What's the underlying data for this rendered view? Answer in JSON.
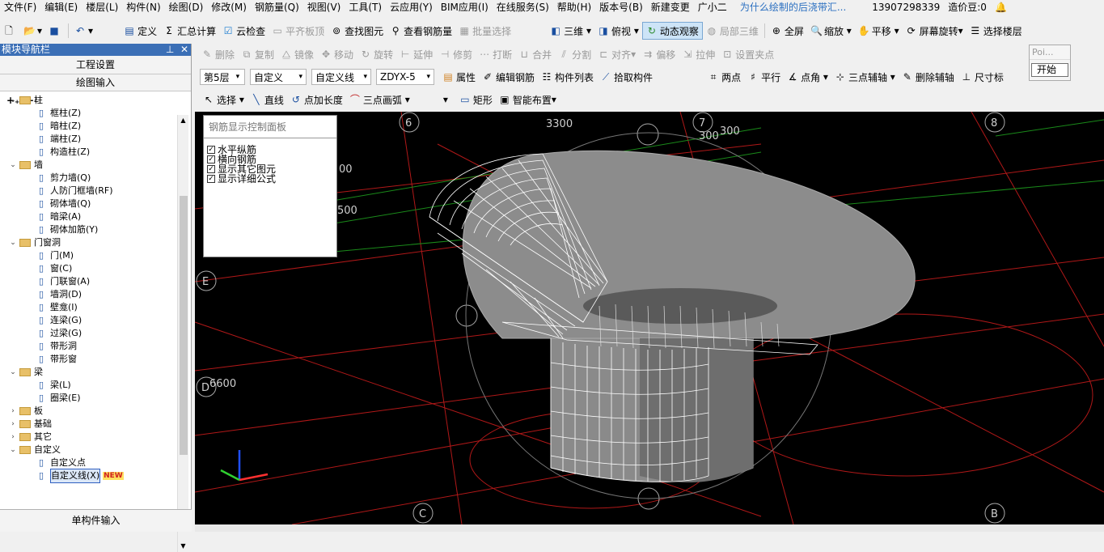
{
  "menu": {
    "items": [
      "文件(F)",
      "编辑(E)",
      "楼层(L)",
      "构件(N)",
      "绘图(D)",
      "修改(M)",
      "钢筋量(Q)",
      "视图(V)",
      "工具(T)",
      "云应用(Y)",
      "BIM应用(I)",
      "在线服务(S)",
      "帮助(H)",
      "版本号(B)",
      "新建变更",
      "广小二",
      "为什么绘制的后浇带汇..."
    ],
    "phone": "13907298339",
    "coins": "造价豆:0"
  },
  "toolbar1": {
    "define": "定义",
    "sum": "汇总计算",
    "cloud_check": "云检查",
    "flush_slab": "平齐板顶",
    "find": "查找图元",
    "view_rebar": "查看钢筋量",
    "batch_select": "批量选择",
    "view_3d": "三维",
    "top_view": "俯视",
    "dynamic_view": "动态观察",
    "local_3d": "局部三维",
    "fullscreen": "全屏",
    "zoom": "缩放",
    "pan": "平移",
    "rotate_screen": "屏幕旋转",
    "select_floor": "选择楼层"
  },
  "toolbar2": {
    "delete": "删除",
    "copy": "复制",
    "mirror": "镜像",
    "move": "移动",
    "rotate": "旋转",
    "extend": "延伸",
    "trim": "修剪",
    "break": "打断",
    "merge": "合并",
    "split": "分割",
    "align": "对齐",
    "offset": "偏移",
    "stretch": "拉伸",
    "set_grip": "设置夹点"
  },
  "toolbar3": {
    "floor": "第5层",
    "category": "自定义",
    "sub_category": "自定义线",
    "component": "ZDYX-5",
    "properties": "属性",
    "edit_rebar": "编辑钢筋",
    "component_list": "构件列表",
    "pick": "拾取构件",
    "two_points": "两点",
    "parallel": "平行",
    "point_angle": "点角",
    "three_point_aux": "三点辅轴",
    "delete_aux": "删除辅轴",
    "dimension": "尺寸标"
  },
  "toolbar4": {
    "select": "选择",
    "line": "直线",
    "point_length": "点加长度",
    "arc": "三点画弧",
    "rect": "矩形",
    "smart_layout": "智能布置"
  },
  "sidebar": {
    "title": "模块导航栏",
    "project_settings": "工程设置",
    "drawing_input": "绘图输入",
    "single_input": "单构件输入",
    "tree": [
      {
        "label": "柱",
        "type": "folder",
        "expanded": true
      },
      {
        "label": "框柱(Z)",
        "type": "leaf"
      },
      {
        "label": "暗柱(Z)",
        "type": "leaf"
      },
      {
        "label": "端柱(Z)",
        "type": "leaf"
      },
      {
        "label": "构造柱(Z)",
        "type": "leaf"
      },
      {
        "label": "墙",
        "type": "folder",
        "expanded": true
      },
      {
        "label": "剪力墙(Q)",
        "type": "leaf"
      },
      {
        "label": "人防门框墙(RF)",
        "type": "leaf"
      },
      {
        "label": "砌体墙(Q)",
        "type": "leaf"
      },
      {
        "label": "暗梁(A)",
        "type": "leaf"
      },
      {
        "label": "砌体加筋(Y)",
        "type": "leaf"
      },
      {
        "label": "门窗洞",
        "type": "folder",
        "expanded": true
      },
      {
        "label": "门(M)",
        "type": "leaf"
      },
      {
        "label": "窗(C)",
        "type": "leaf"
      },
      {
        "label": "门联窗(A)",
        "type": "leaf"
      },
      {
        "label": "墙洞(D)",
        "type": "leaf"
      },
      {
        "label": "壁龛(I)",
        "type": "leaf"
      },
      {
        "label": "连梁(G)",
        "type": "leaf"
      },
      {
        "label": "过梁(G)",
        "type": "leaf"
      },
      {
        "label": "带形洞",
        "type": "leaf"
      },
      {
        "label": "带形窗",
        "type": "leaf"
      },
      {
        "label": "梁",
        "type": "folder",
        "expanded": true
      },
      {
        "label": "梁(L)",
        "type": "leaf"
      },
      {
        "label": "圈梁(E)",
        "type": "leaf"
      },
      {
        "label": "板",
        "type": "folder",
        "expanded": false
      },
      {
        "label": "基础",
        "type": "folder",
        "expanded": false
      },
      {
        "label": "其它",
        "type": "folder",
        "expanded": false
      },
      {
        "label": "自定义",
        "type": "folder",
        "expanded": true
      },
      {
        "label": "自定义点",
        "type": "leaf"
      },
      {
        "label": "自定义线(X)",
        "type": "leaf",
        "badge": "NEW"
      }
    ]
  },
  "rebar_panel": {
    "title": "钢筋显示控制面板",
    "options": [
      "水平纵筋",
      "横向钢筋",
      "显示其它图元",
      "显示详细公式"
    ]
  },
  "popup": {
    "poi": "Poi...",
    "start": "开始"
  },
  "viewport": {
    "axis_labels": [
      "6",
      "7",
      "8",
      "E",
      "D",
      "C",
      "B"
    ],
    "dims": [
      "3300",
      "300",
      "300",
      "00",
      "500",
      "6600"
    ],
    "colors": {
      "bg": "#000000",
      "grid": "#cc1a1a",
      "rebar": "#ffffff",
      "concrete": "#8a8a8a",
      "aux": "#22aa22"
    }
  }
}
